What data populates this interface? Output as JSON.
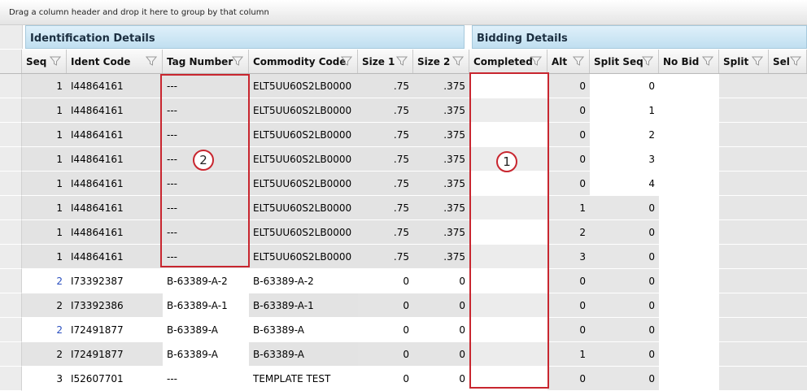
{
  "group_panel_text": "Drag a column header and drop it here to group by that column",
  "bands": {
    "identification": "Identification Details",
    "bidding": "Bidding Details"
  },
  "columns": [
    "Seq",
    "Ident Code",
    "Tag Number",
    "Commodity Code",
    "Size 1",
    "Size 2",
    "Completed",
    "Alt",
    "Split Seq",
    "No Bid",
    "Split",
    "Sel"
  ],
  "rows": [
    {
      "seq": "1",
      "ident": "I44864161",
      "tag": "---",
      "commodity": "ELT5UU60S2LB0000",
      "size1": ".75",
      "size2": ".375",
      "completed": "",
      "alt": "0",
      "split_seq": "0"
    },
    {
      "seq": "1",
      "ident": "I44864161",
      "tag": "---",
      "commodity": "ELT5UU60S2LB0000",
      "size1": ".75",
      "size2": ".375",
      "completed": "",
      "alt": "0",
      "split_seq": "1"
    },
    {
      "seq": "1",
      "ident": "I44864161",
      "tag": "---",
      "commodity": "ELT5UU60S2LB0000",
      "size1": ".75",
      "size2": ".375",
      "completed": "",
      "alt": "0",
      "split_seq": "2"
    },
    {
      "seq": "1",
      "ident": "I44864161",
      "tag": "---",
      "commodity": "ELT5UU60S2LB0000",
      "size1": ".75",
      "size2": ".375",
      "completed": "",
      "alt": "0",
      "split_seq": "3"
    },
    {
      "seq": "1",
      "ident": "I44864161",
      "tag": "---",
      "commodity": "ELT5UU60S2LB0000",
      "size1": ".75",
      "size2": ".375",
      "completed": "",
      "alt": "0",
      "split_seq": "4"
    },
    {
      "seq": "1",
      "ident": "I44864161",
      "tag": "---",
      "commodity": "ELT5UU60S2LB0000",
      "size1": ".75",
      "size2": ".375",
      "completed": "",
      "alt": "1",
      "split_seq": "0"
    },
    {
      "seq": "1",
      "ident": "I44864161",
      "tag": "---",
      "commodity": "ELT5UU60S2LB0000",
      "size1": ".75",
      "size2": ".375",
      "completed": "",
      "alt": "2",
      "split_seq": "0"
    },
    {
      "seq": "1",
      "ident": "I44864161",
      "tag": "---",
      "commodity": "ELT5UU60S2LB0000",
      "size1": ".75",
      "size2": ".375",
      "completed": "",
      "alt": "3",
      "split_seq": "0"
    },
    {
      "seq": "2",
      "ident": "I73392387",
      "tag": "B-63389-A-2",
      "commodity": "B-63389-A-2",
      "size1": "0",
      "size2": "0",
      "completed": "",
      "alt": "0",
      "split_seq": "0"
    },
    {
      "seq": "2",
      "ident": "I73392386",
      "tag": "B-63389-A-1",
      "commodity": "B-63389-A-1",
      "size1": "0",
      "size2": "0",
      "completed": "",
      "alt": "0",
      "split_seq": "0"
    },
    {
      "seq": "2",
      "ident": "I72491877",
      "tag": "B-63389-A",
      "commodity": "B-63389-A",
      "size1": "0",
      "size2": "0",
      "completed": "",
      "alt": "0",
      "split_seq": "0"
    },
    {
      "seq": "2",
      "ident": "I72491877",
      "tag": "B-63389-A",
      "commodity": "B-63389-A",
      "size1": "0",
      "size2": "0",
      "completed": "",
      "alt": "1",
      "split_seq": "0"
    },
    {
      "seq": "3",
      "ident": "I52607701",
      "tag": "---",
      "commodity": "TEMPLATE TEST",
      "size1": "0",
      "size2": "0",
      "completed": "",
      "alt": "0",
      "split_seq": "0"
    }
  ],
  "callouts": [
    "1",
    "2"
  ],
  "colors": {
    "callout": "#c8262f",
    "band": "#c0dff0",
    "row_alt": "#e4e4e4",
    "seq_link": "#2a4fbf"
  }
}
